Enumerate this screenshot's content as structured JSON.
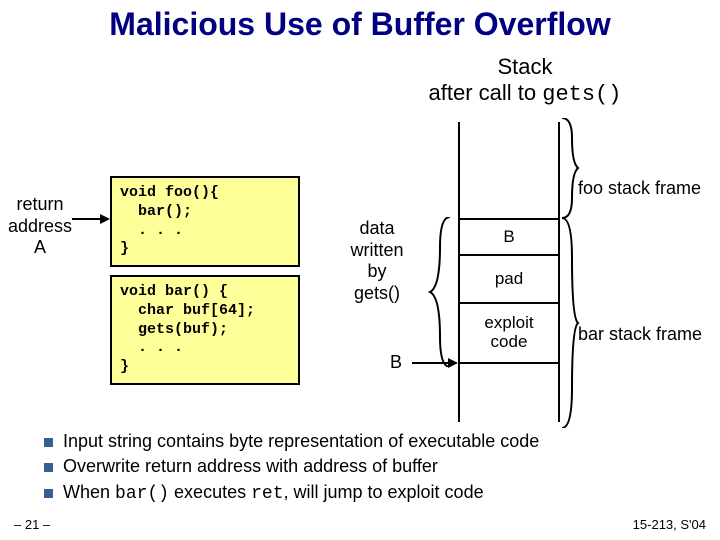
{
  "title": "Malicious Use of Buffer Overflow",
  "subtitle_line1": "Stack",
  "subtitle_line2_pre": "after call to ",
  "subtitle_line2_code": "gets()",
  "return_label": "return\naddress\nA",
  "code_foo": "void foo(){\n  bar();\n  . . .\n}",
  "code_bar": "void bar() {\n  char buf[64];\n  gets(buf);\n  . . .\n}",
  "stack": {
    "B": "B",
    "pad": "pad",
    "exploit": "exploit\ncode"
  },
  "data_written": "data\nwritten\nby\ngets()",
  "label_B": "B",
  "foo_frame": "foo stack frame",
  "bar_frame": "bar stack frame",
  "bullets": {
    "b1": "Input string contains byte representation of executable code",
    "b2": "Overwrite return address with address of buffer",
    "b3_pre": "When ",
    "b3_code1": "bar()",
    "b3_mid": " executes ",
    "b3_code2": "ret",
    "b3_post": ", will jump to exploit code"
  },
  "page_num": "– 21 –",
  "course": "15-213, S'04"
}
